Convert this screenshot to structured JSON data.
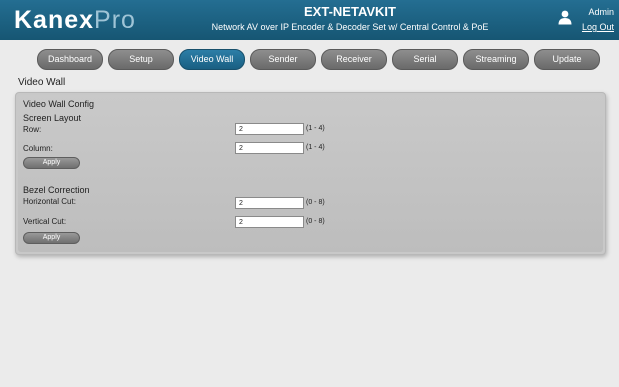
{
  "header": {
    "logo_main": "Kanex",
    "logo_accent": "Pro",
    "title": "EXT-NETAVKIT",
    "subtitle": "Network AV over IP Encoder & Decoder Set w/ Central Control & PoE",
    "user_name": "Admin",
    "logout_label": "Log Out"
  },
  "nav": {
    "items": [
      {
        "label": "Dashboard"
      },
      {
        "label": "Setup"
      },
      {
        "label": "Video Wall"
      },
      {
        "label": "Sender"
      },
      {
        "label": "Receiver"
      },
      {
        "label": "Serial"
      },
      {
        "label": "Streaming"
      },
      {
        "label": "Update"
      }
    ],
    "active": "Video Wall"
  },
  "page": {
    "title": "Video Wall"
  },
  "config": {
    "title": "Video Wall Config",
    "screen_layout": {
      "title": "Screen Layout",
      "row_label": "Row:",
      "row_value": "2",
      "row_range": "(1 - 4)",
      "column_label": "Column:",
      "column_value": "2",
      "column_range": "(1 - 4)",
      "apply_label": "Apply"
    },
    "bezel": {
      "title": "Bezel Correction",
      "horizontal_label": "Horizontal Cut:",
      "horizontal_value": "2",
      "horizontal_range": "(0 - 8)",
      "vertical_label": "Vertical Cut:",
      "vertical_value": "2",
      "vertical_range": "(0 - 8)",
      "apply_label": "Apply"
    }
  },
  "colors": {
    "header_bg": "#1d6283",
    "nav_active": "#23719a",
    "nav_inactive": "#7c7c7c",
    "panel_bg": "#c4c4c4",
    "page_bg": "#ebebeb"
  }
}
